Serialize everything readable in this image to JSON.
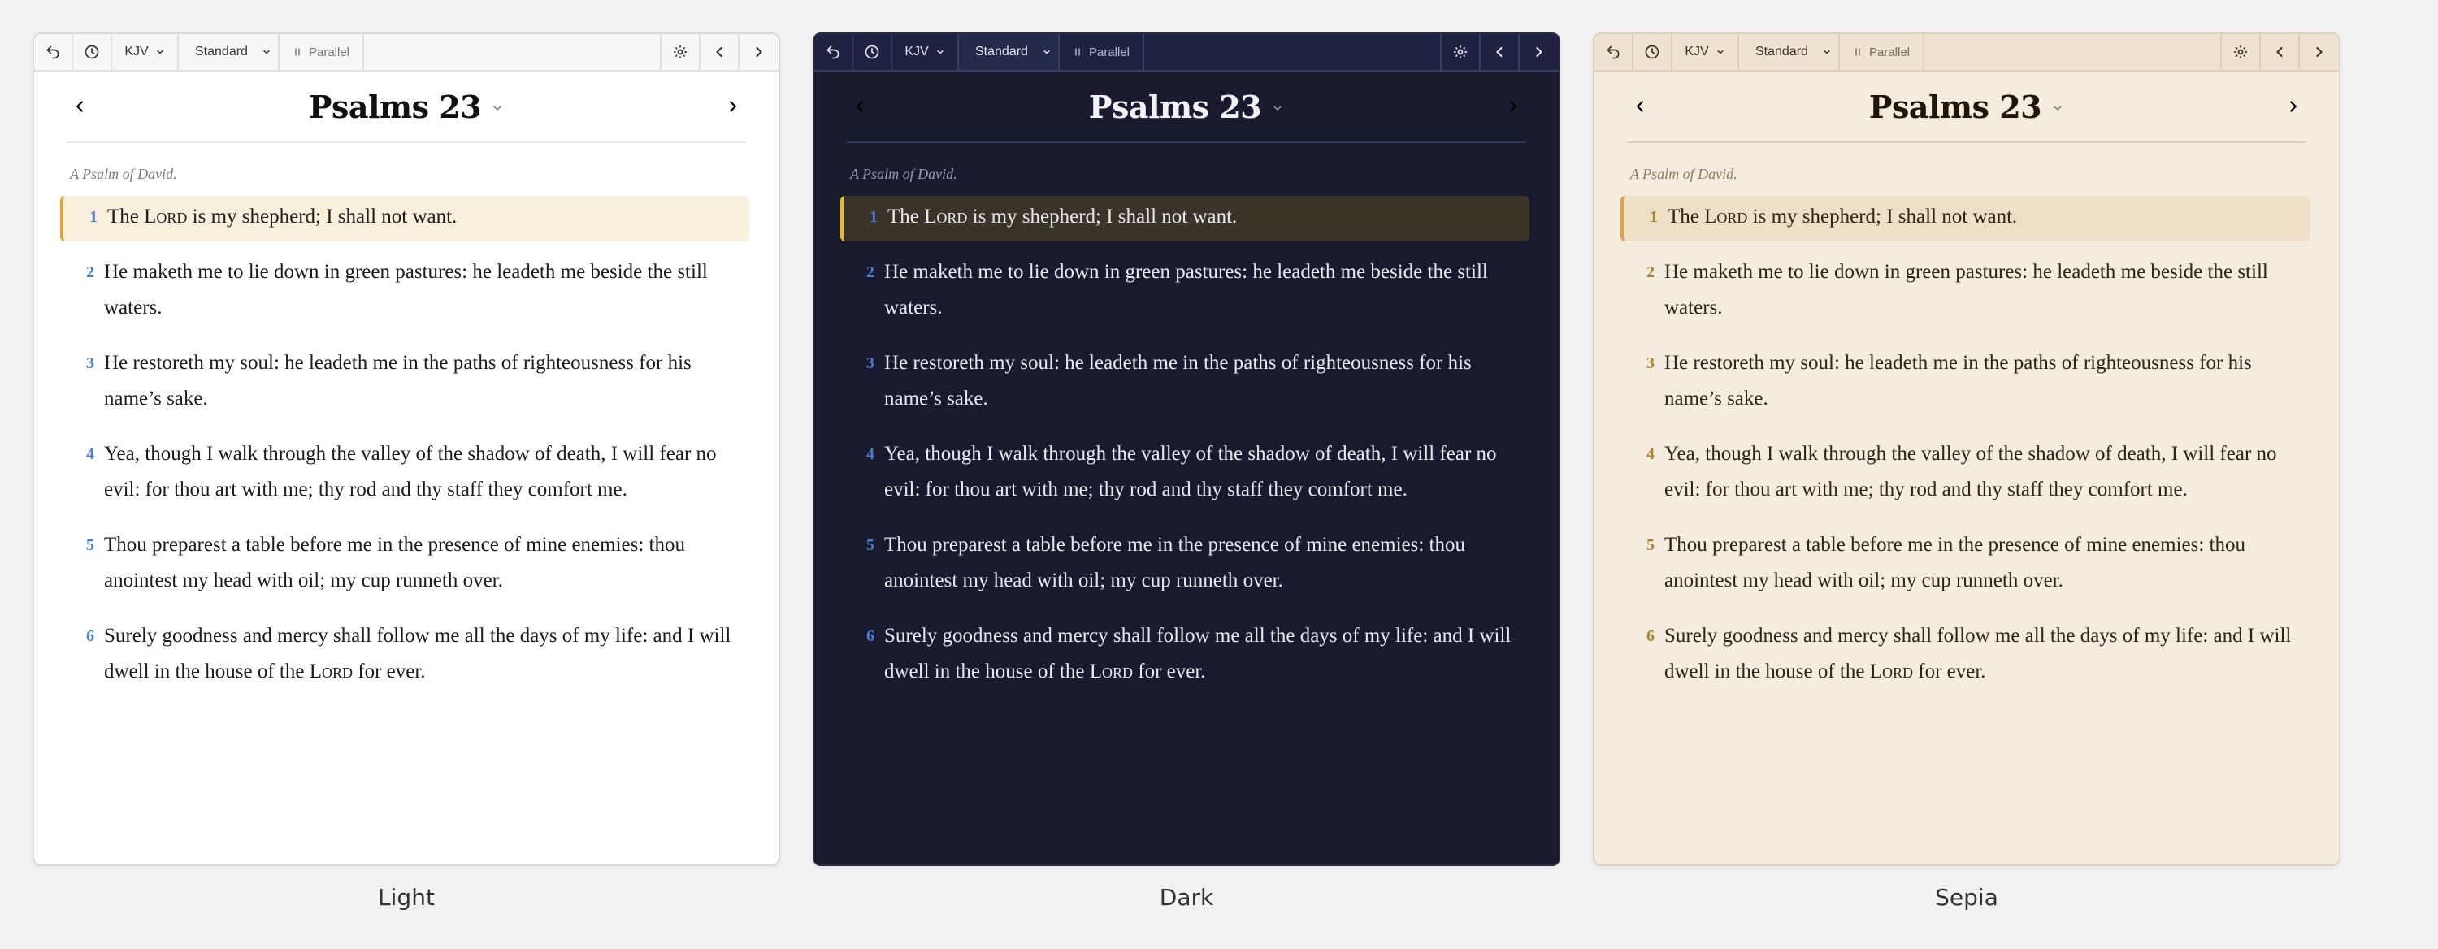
{
  "toolbar": {
    "back_icon": "undo-arrow-icon",
    "history_icon": "clock-icon",
    "version_label": "KJV",
    "mode_label": "Standard",
    "parallel_label": "Parallel",
    "settings_icon": "gear-icon"
  },
  "chapter": {
    "title": "Psalms 23",
    "superscription": "A Psalm of David.",
    "verses": [
      {
        "n": "1",
        "pre": "The ",
        "sc": "Lord",
        "post": " is my shepherd; I shall not want.",
        "active": true
      },
      {
        "n": "2",
        "text": "He maketh me to lie down in green pastures: he leadeth me beside the still waters."
      },
      {
        "n": "3",
        "text": "He restoreth my soul: he leadeth me in the paths of righteousness for his name’s sake."
      },
      {
        "n": "4",
        "text": "Yea, though I walk through the valley of the shadow of death, I will fear no evil: for thou art with me; thy rod and thy staff they comfort me."
      },
      {
        "n": "5",
        "text": "Thou preparest a table before me in the presence of mine enemies: thou anointest my head with oil; my cup runneth over."
      },
      {
        "n": "6",
        "pre": "Surely goodness and mercy shall follow me all the days of my life: and I will dwell in the house of the ",
        "sc": "Lord",
        "post": " for ever."
      }
    ]
  },
  "themes": [
    {
      "id": "light",
      "label": "Light"
    },
    {
      "id": "dark",
      "label": "Dark"
    },
    {
      "id": "sepia",
      "label": "Sepia"
    }
  ],
  "colors": {
    "verse_number_blue": "#4a7ed6",
    "verse_number_sepia": "#a7852e",
    "highlight_accent": "#e0a63c",
    "dark_background": "#1a1a2e",
    "sepia_background": "#f4ecdf"
  }
}
